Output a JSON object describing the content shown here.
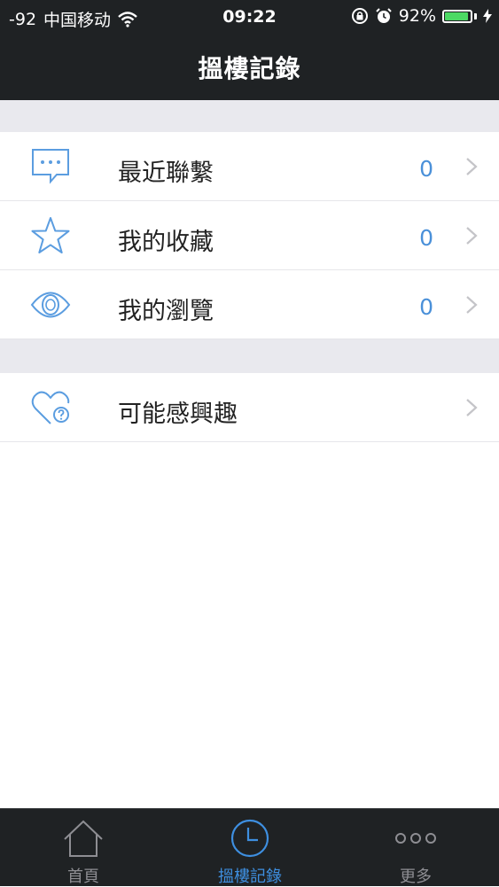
{
  "status_bar": {
    "signal": "-92",
    "carrier": "中国移动",
    "time": "09:22",
    "battery_percent": "92%",
    "battery_level": 0.92
  },
  "nav": {
    "title": "搵樓記錄"
  },
  "items": [
    {
      "label": "最近聯繫",
      "count": "0",
      "icon": "chat-bubble-icon"
    },
    {
      "label": "我的收藏",
      "count": "0",
      "icon": "star-icon"
    },
    {
      "label": "我的瀏覽",
      "count": "0",
      "icon": "eye-icon"
    },
    {
      "label": "可能感興趣",
      "count": "",
      "icon": "heart-question-icon"
    }
  ],
  "tabs": [
    {
      "label": "首頁",
      "icon": "home-icon",
      "active": false
    },
    {
      "label": "搵樓記錄",
      "icon": "clock-icon",
      "active": true
    },
    {
      "label": "更多",
      "icon": "more-dots-icon",
      "active": false
    }
  ],
  "colors": {
    "bar_background": "#1f2224",
    "accent": "#3e8fe0",
    "icon_outline": "#5b9de0",
    "section_gap": "#e9e9ee",
    "battery": "#4cd964"
  }
}
